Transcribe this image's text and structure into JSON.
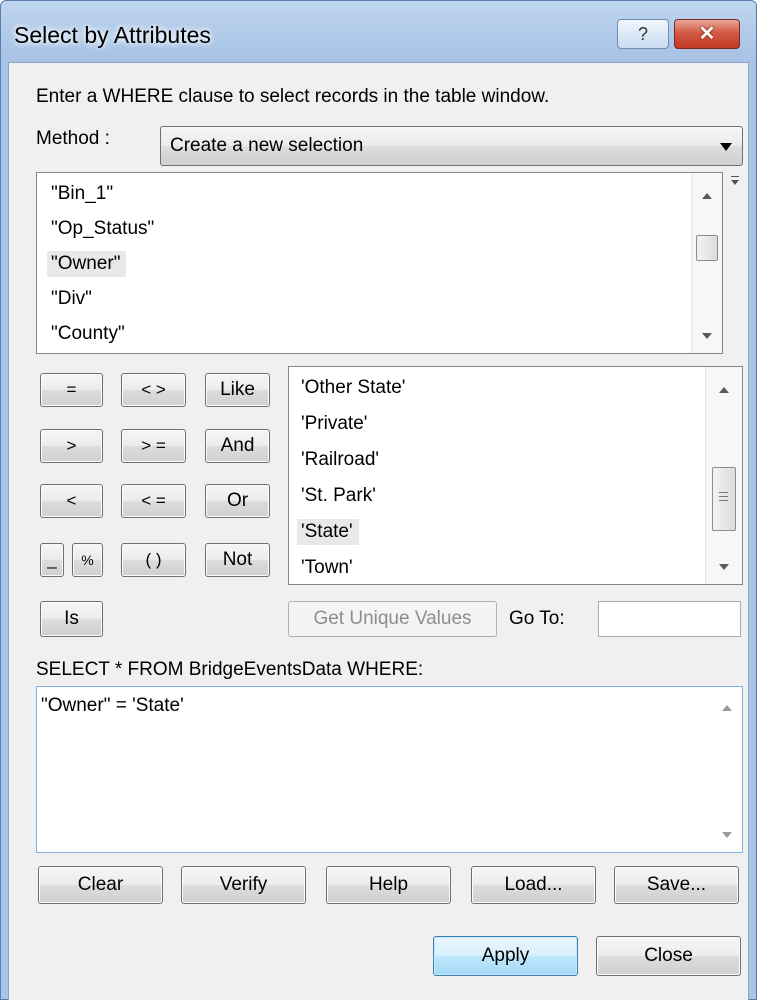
{
  "window": {
    "title": "Select by Attributes",
    "help_label": "?",
    "close_label": "✕"
  },
  "instruction": "Enter a WHERE clause to select records in the table window.",
  "method": {
    "label": "Method :",
    "value": "Create a new selection"
  },
  "fields": [
    "\"Bin_1\"",
    "\"Op_Status\"",
    "\"Owner\"",
    "\"Div\"",
    "\"County\""
  ],
  "fields_selected": "\"Owner\"",
  "operators": {
    "eq": "=",
    "ne": "< >",
    "like": "Like",
    "gt": ">",
    "ge": "> =",
    "and": "And",
    "lt": "<",
    "le": "< =",
    "or": "Or",
    "underscore": "_",
    "percent": "%",
    "parens": "( )",
    "not": "Not",
    "is": "Is"
  },
  "values": [
    "'Other State'",
    "'Private'",
    "'Railroad'",
    "'St. Park'",
    "'State'",
    "'Town'"
  ],
  "values_selected": "'State'",
  "get_unique_values": "Get Unique Values",
  "goto": {
    "label": "Go To:",
    "value": ""
  },
  "select_statement": "SELECT * FROM BridgeEventsData WHERE:",
  "where_clause": "\"Owner\" = 'State'",
  "actions": {
    "clear": "Clear",
    "verify": "Verify",
    "help": "Help",
    "load": "Load...",
    "save": "Save..."
  },
  "footer": {
    "apply": "Apply",
    "close": "Close"
  }
}
